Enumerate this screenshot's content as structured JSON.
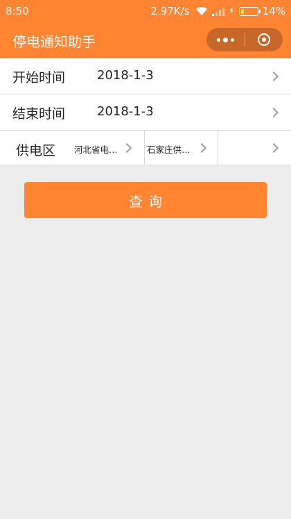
{
  "status_bar": {
    "time": "8:50",
    "network_speed": "2.97K/s",
    "battery_percent": "14%",
    "battery_level": 0.14,
    "icons": [
      "wifi-icon",
      "signal-icon",
      "charging-icon",
      "battery-icon"
    ]
  },
  "nav": {
    "title": "停电通知助手",
    "capsule_icons": [
      "more-icon",
      "close-miniprogram-icon"
    ]
  },
  "form": {
    "start": {
      "label": "开始时间",
      "value": "2018-1-3"
    },
    "end": {
      "label": "结束时间",
      "value": "2018-1-3"
    },
    "region": {
      "label": "供电区",
      "level1": "河北省电…",
      "level2": "石家庄供…",
      "level3": ""
    }
  },
  "query_button_label": "查询",
  "colors": {
    "primary": "#ff8533",
    "background": "#ededed",
    "divider": "#d9d9d9"
  }
}
